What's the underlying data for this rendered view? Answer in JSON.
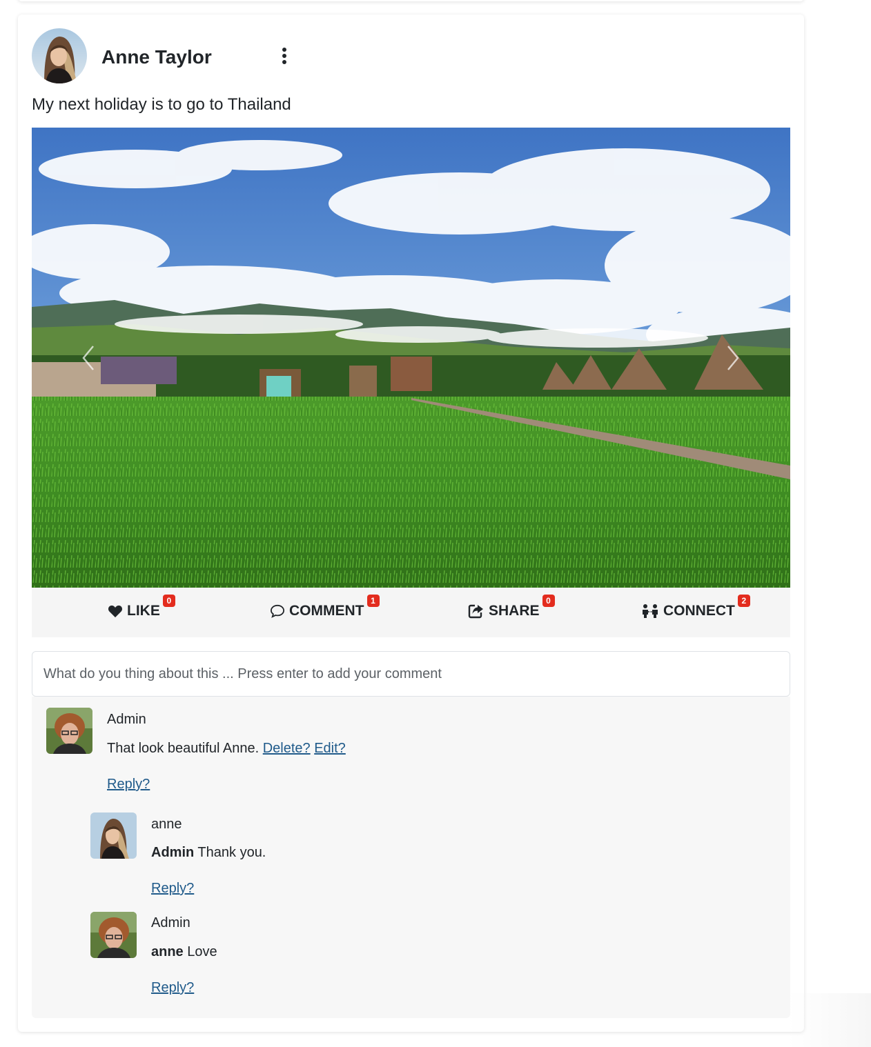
{
  "post": {
    "author": "Anne Taylor",
    "text": "My next holiday is to go to Thailand",
    "menu_icon": "more-vertical-icon",
    "image_subject": "rice field with huts and mountains"
  },
  "actions": {
    "like": {
      "label": "LIKE",
      "count": "0",
      "icon": "heart-icon"
    },
    "comment": {
      "label": "COMMENT",
      "count": "1",
      "icon": "comment-icon"
    },
    "share": {
      "label": "SHARE",
      "count": "0",
      "icon": "share-icon"
    },
    "connect": {
      "label": "CONNECT",
      "count": "2",
      "icon": "connect-icon"
    }
  },
  "comment_box": {
    "placeholder": "What do you thing about this ... Press enter to add your comment",
    "value": ""
  },
  "comments": [
    {
      "author": "Admin",
      "text": "That look beautiful Anne.",
      "delete_label": "Delete?",
      "edit_label": "Edit?",
      "reply_label": "Reply?"
    },
    {
      "author": "anne",
      "mention": "Admin",
      "text": "Thank you.",
      "reply_label": "Reply?"
    },
    {
      "author": "Admin",
      "mention": "anne",
      "text": "Love",
      "reply_label": "Reply?"
    }
  ],
  "colors": {
    "badge": "#e32c1e",
    "link": "#1f5a8a",
    "action_bar_bg": "#f5f5f5",
    "comments_bg": "#f7f7f7"
  }
}
